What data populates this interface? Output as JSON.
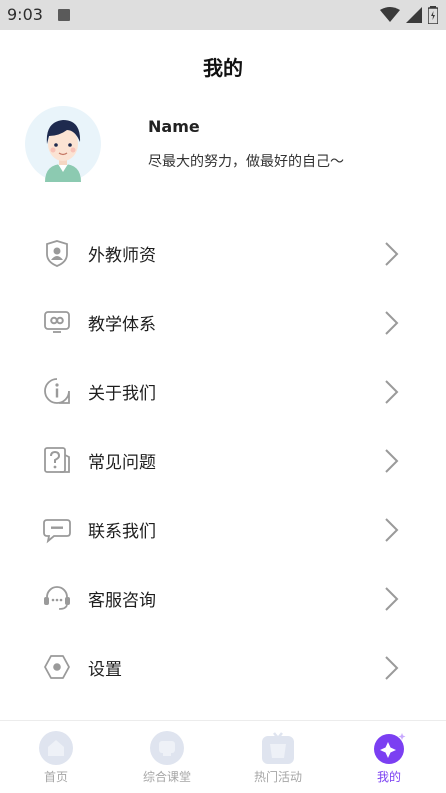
{
  "status_bar": {
    "time": "9:03"
  },
  "page": {
    "title": "我的"
  },
  "profile": {
    "name": "Name",
    "motto": "尽最大的努力，做最好的自己～"
  },
  "menu": [
    {
      "label": "外教师资",
      "icon": "teacher-shield-icon"
    },
    {
      "label": "教学体系",
      "icon": "monitor-icon"
    },
    {
      "label": "关于我们",
      "icon": "info-icon"
    },
    {
      "label": "常见问题",
      "icon": "question-icon"
    },
    {
      "label": "联系我们",
      "icon": "chat-icon"
    },
    {
      "label": "客服咨询",
      "icon": "headset-icon"
    },
    {
      "label": "设置",
      "icon": "settings-icon"
    }
  ],
  "tabs": [
    {
      "label": "首页",
      "icon": "home-icon",
      "active": false
    },
    {
      "label": "综合课堂",
      "icon": "classroom-icon",
      "active": false
    },
    {
      "label": "热门活动",
      "icon": "activity-icon",
      "active": false
    },
    {
      "label": "我的",
      "icon": "profile-star-icon",
      "active": true
    }
  ],
  "colors": {
    "accent": "#7b3ff2",
    "tab_inactive": "#a6a6a6",
    "icon_gray": "#9a9a9a"
  }
}
